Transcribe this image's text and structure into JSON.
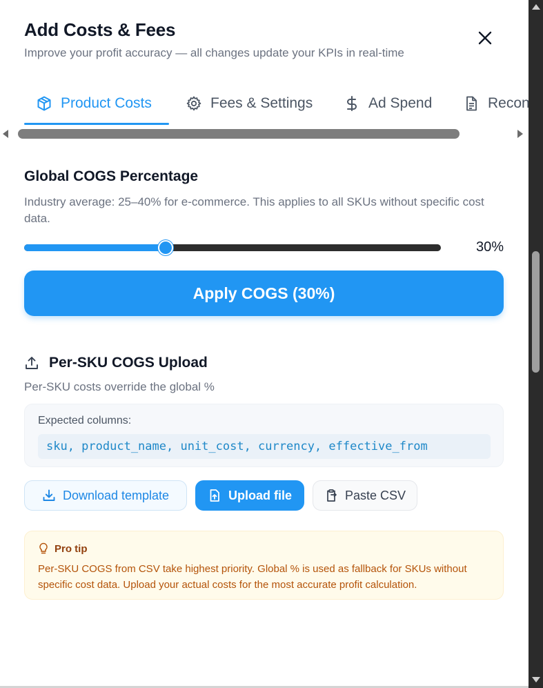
{
  "header": {
    "title": "Add Costs & Fees",
    "subtitle": "Improve your profit accuracy — all changes update your KPIs in real-time"
  },
  "tabs": [
    {
      "label": "Product Costs",
      "icon": "package-icon",
      "active": true
    },
    {
      "label": "Fees & Settings",
      "icon": "gear-icon",
      "active": false
    },
    {
      "label": "Ad Spend",
      "icon": "dollar-icon",
      "active": false
    },
    {
      "label": "Recon",
      "icon": "document-icon",
      "active": false
    }
  ],
  "global_cogs": {
    "title": "Global COGS Percentage",
    "description": "Industry average: 25–40% for e-commerce. This applies to all SKUs without specific cost data.",
    "slider_value": 0.34,
    "value_label": "30%",
    "apply_label": "Apply COGS (30%)"
  },
  "per_sku": {
    "title": "Per-SKU COGS Upload",
    "description": "Per-SKU costs override the global %",
    "expected_label": "Expected columns:",
    "columns_code": "sku, product_name, unit_cost, currency, effective_from",
    "download_label": "Download template",
    "upload_label": "Upload file",
    "paste_label": "Paste CSV"
  },
  "pro_tip": {
    "title": "Pro tip",
    "body": "Per-SKU COGS from CSV take highest priority. Global % is used as fallback for SKUs without specific cost data. Upload your actual costs for the most accurate profit calculation."
  },
  "colors": {
    "accent": "#2196f3",
    "tip_text": "#b45309",
    "tip_background": "#fffbeb"
  }
}
